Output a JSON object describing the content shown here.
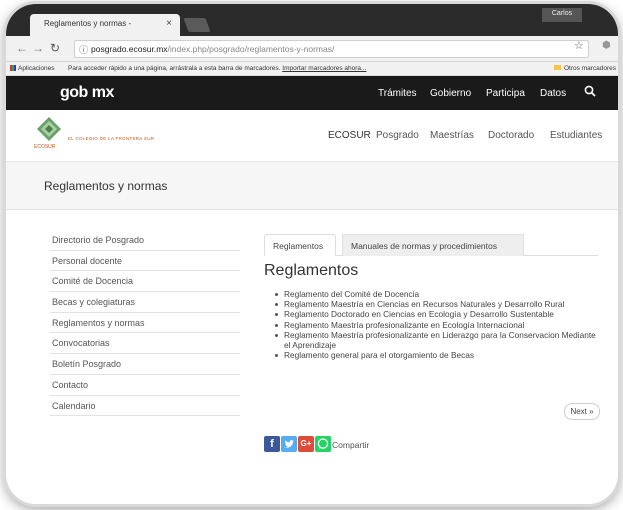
{
  "browser": {
    "tab_title": "Reglamentos y normas -",
    "tab_close": "×",
    "user": "Carlos",
    "url_host": "posgrado.ecosur.mx",
    "url_path": "/index.php/posgrado/reglamentos-y-normas/",
    "bookmarks": {
      "apps_label": "Aplicaciones",
      "hint": "Para acceder rápido a una página, arrástrala a esta barra de marcadores.",
      "import_link": "Importar marcadores ahora...",
      "other_label": "Otros marcadores"
    }
  },
  "gob": {
    "logo": "gob mx",
    "nav": [
      "Trámites",
      "Gobierno",
      "Participa",
      "Datos"
    ]
  },
  "site": {
    "logo_name": "EL COLEGIO DE LA FRONTERA SUR",
    "logo_abbr": "ECOSUR",
    "nav": [
      "ECOSUR",
      "Posgrado",
      "Maestrías",
      "Doctorado",
      "Estudiantes"
    ]
  },
  "page": {
    "title": "Reglamentos y normas"
  },
  "sidebar": {
    "items": [
      "Directorio de Posgrado",
      "Personal docente",
      "Comité de Docencia",
      "Becas y colegiaturas",
      "Reglamentos y normas",
      "Convocatorias",
      "Boletín Posgrado",
      "Contacto",
      "Calendario"
    ]
  },
  "content": {
    "tabs": [
      "Reglamentos",
      "Manuales de normas y procedimientos"
    ],
    "heading": "Reglamentos",
    "documents": [
      "Reglamento del Comité de Docencia",
      "Reglamento Maestría en Ciencias en Recursos Naturales y Desarrollo Rural",
      "Reglamento Doctorado en Ciencias en Ecología y Desarrollo Sustentable",
      "Reglamento Maestría profesionalizante en Ecología Internacional",
      "Reglamento Maestría profesionalizante en Liderazgo para la Conservacion Mediante el Aprendizaje",
      "Reglamento general para el otorgamiento de Becas"
    ],
    "next_label": "Next »"
  },
  "share": {
    "label": "Compartir",
    "icons": [
      "facebook-icon",
      "twitter-icon",
      "google-plus-icon",
      "whatsapp-icon"
    ],
    "colors": {
      "facebook": "#3b5998",
      "twitter": "#55acee",
      "google_plus": "#dd4b39",
      "whatsapp": "#25d366"
    }
  }
}
